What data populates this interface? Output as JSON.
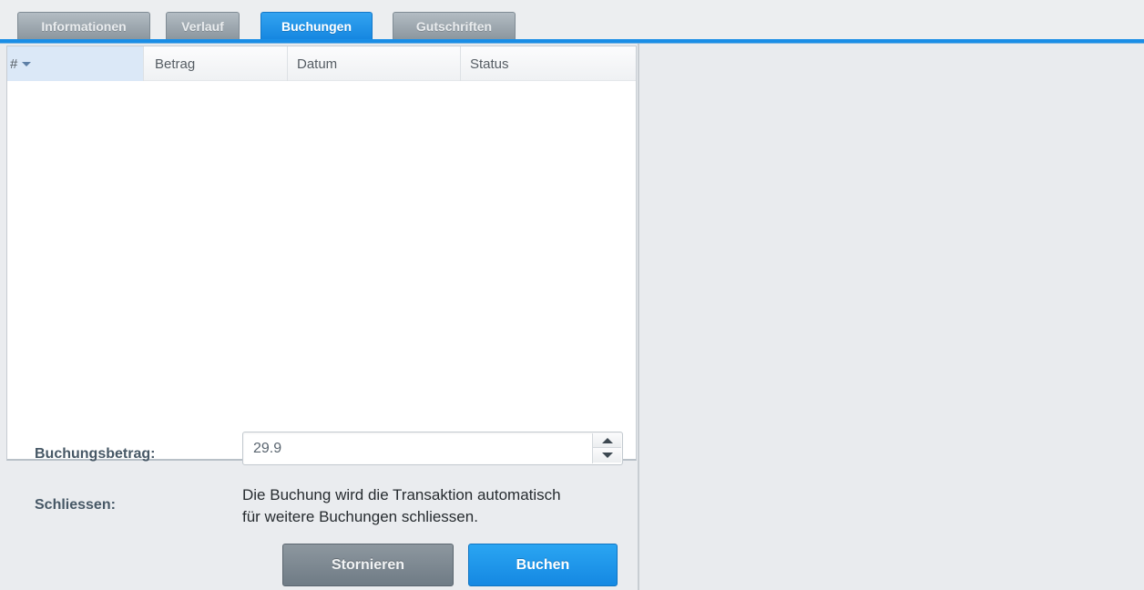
{
  "tabs": [
    {
      "label": "Informationen",
      "active": false
    },
    {
      "label": "Verlauf",
      "active": false
    },
    {
      "label": "Buchungen",
      "active": true
    },
    {
      "label": "Gutschriften",
      "active": false
    }
  ],
  "grid": {
    "columns": [
      "#",
      "Betrag",
      "Datum",
      "Status"
    ],
    "sorted_column": "#",
    "sort_direction": "desc",
    "rows": []
  },
  "form": {
    "amount_label": "Buchungsbetrag:",
    "amount_value": "29.9",
    "close_label": "Schliessen:",
    "close_text_line1": "Die Buchung wird die Transaktion automatisch",
    "close_text_line2": "für weitere Buchungen schliessen."
  },
  "buttons": {
    "cancel_label": "Stornieren",
    "submit_label": "Buchen"
  },
  "colors": {
    "accent": "#1a8ee6",
    "tab_inactive": "#9aa4ac",
    "button_gray": "#7d8892"
  }
}
